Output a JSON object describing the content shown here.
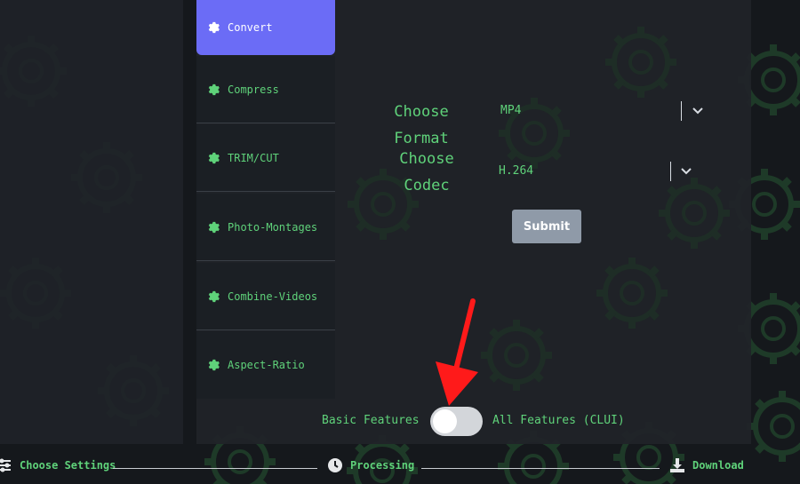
{
  "sidebar": {
    "items": [
      {
        "label": "Convert",
        "icon": "gear-icon",
        "active": true
      },
      {
        "label": "Compress",
        "icon": "gear-icon"
      },
      {
        "label": "TRIM/CUT",
        "icon": "gear-icon"
      },
      {
        "label": "Photo-Montages",
        "icon": "gear-icon"
      },
      {
        "label": "Combine-Videos",
        "icon": "gear-icon"
      },
      {
        "label": "Aspect-Ratio",
        "icon": "gear-icon"
      }
    ]
  },
  "form": {
    "format_label": "Choose Format",
    "format_value": "MP4",
    "codec_label_line1": "Choose",
    "codec_label_line2": "Codec",
    "codec_value": "H.264",
    "submit_label": "Submit"
  },
  "features_toggle": {
    "left_label": "Basic Features",
    "right_label": "All Features (CLUI)",
    "state": "off"
  },
  "steps": [
    {
      "label": "Choose Settings",
      "icon": "settings-sliders-icon"
    },
    {
      "label": "Processing",
      "icon": "clock-icon"
    },
    {
      "label": "Download",
      "icon": "download-icon"
    }
  ],
  "colors": {
    "accent_green": "#5fd27a",
    "active_tab": "#6b6cf6",
    "submit_button": "#8f9aa8",
    "annotation_arrow": "#ff1a1a"
  }
}
